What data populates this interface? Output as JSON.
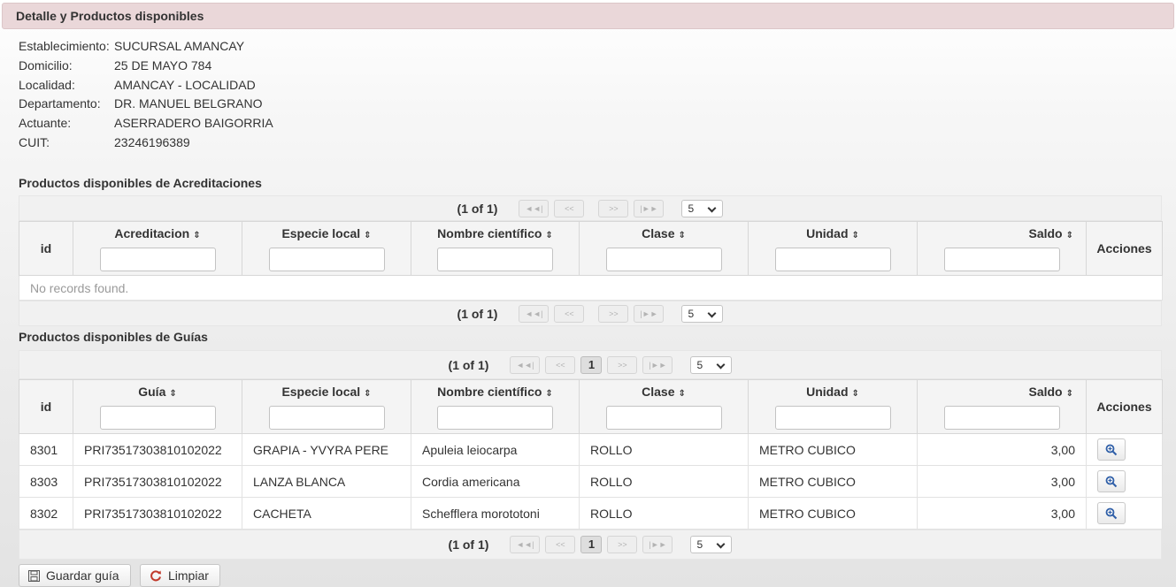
{
  "header": {
    "title": "Detalle y Productos disponibles"
  },
  "info": [
    {
      "label": "Establecimiento:",
      "value": "SUCURSAL AMANCAY"
    },
    {
      "label": "Domicilio:",
      "value": "25 DE MAYO 784"
    },
    {
      "label": "Localidad:",
      "value": "AMANCAY - LOCALIDAD"
    },
    {
      "label": "Departamento:",
      "value": "DR. MANUEL BELGRANO"
    },
    {
      "label": "Actuante:",
      "value": "ASERRADERO BAIGORRIA"
    },
    {
      "label": "CUIT:",
      "value": "23246196389"
    }
  ],
  "acreditaciones": {
    "title": "Productos disponibles de Acreditaciones",
    "page_report": "(1 of 1)",
    "rows_per_page": "5",
    "columns": [
      "id",
      "Acreditacion",
      "Especie local",
      "Nombre científico",
      "Clase",
      "Unidad",
      "Saldo",
      "Acciones"
    ],
    "empty_message": "No records found."
  },
  "guias": {
    "title": "Productos disponibles de Guías",
    "page_report": "(1 of 1)",
    "current_page": "1",
    "rows_per_page": "5",
    "columns": [
      "id",
      "Guía",
      "Especie local",
      "Nombre científico",
      "Clase",
      "Unidad",
      "Saldo",
      "Acciones"
    ],
    "rows": [
      {
        "id": "8301",
        "guia": "PRI73517303810102022",
        "especie": "GRAPIA - YVYRA PERE",
        "nombre": "Apuleia leiocarpa",
        "clase": "ROLLO",
        "unidad": "METRO CUBICO",
        "saldo": "3,00"
      },
      {
        "id": "8303",
        "guia": "PRI73517303810102022",
        "especie": "LANZA BLANCA",
        "nombre": "Cordia americana",
        "clase": "ROLLO",
        "unidad": "METRO CUBICO",
        "saldo": "3,00"
      },
      {
        "id": "8302",
        "guia": "PRI73517303810102022",
        "especie": "CACHETA",
        "nombre": "Schefflera morototoni",
        "clase": "ROLLO",
        "unidad": "METRO CUBICO",
        "saldo": "3,00"
      }
    ]
  },
  "paginator_icons": {
    "first": "◄◄|",
    "prev": "<<",
    "next": ">>",
    "last": "|►►"
  },
  "actions": {
    "save_label": "Guardar guía",
    "clear_label": "Limpiar"
  },
  "colors": {
    "header_bg": "#ead7d9",
    "view_icon": "#2f5fa8",
    "refresh_icon": "#c0392b"
  }
}
